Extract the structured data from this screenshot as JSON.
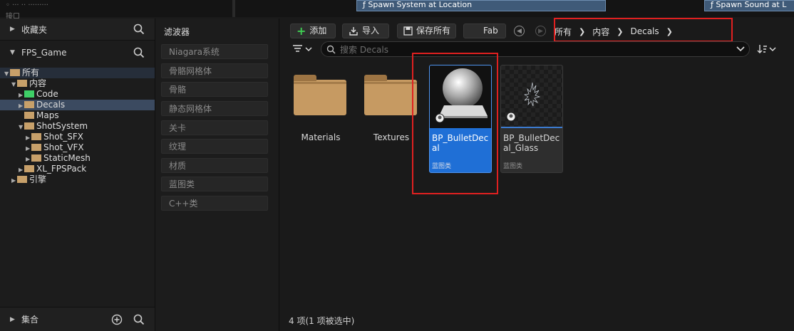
{
  "background_strip": {
    "ghost_text": "◦ ··· ·· ·········",
    "ghost_text2": "接口",
    "node1": "Spawn System at Location",
    "node2": "Spawn Sound at L"
  },
  "tree_panel": {
    "favorites": "收藏夹",
    "project": "FPS_Game",
    "collections": "集合",
    "items": [
      {
        "label": "所有"
      },
      {
        "label": "内容"
      },
      {
        "label": "Code"
      },
      {
        "label": "Decals"
      },
      {
        "label": "Maps"
      },
      {
        "label": "ShotSystem"
      },
      {
        "label": "Shot_SFX"
      },
      {
        "label": "Shot_VFX"
      },
      {
        "label": "StaticMesh"
      },
      {
        "label": "XL_FPSPack"
      },
      {
        "label": "引擎"
      }
    ]
  },
  "filter_panel": {
    "title": "滤波器",
    "items": [
      "Niagara系统",
      "骨骼网格体",
      "骨骼",
      "静态网格体",
      "关卡",
      "纹理",
      "材质",
      "蓝图类",
      "C++类"
    ]
  },
  "toolbar": {
    "add": "添加",
    "import": "导入",
    "save_all": "保存所有",
    "fab": "Fab"
  },
  "breadcrumb": [
    "所有",
    "内容",
    "Decals"
  ],
  "search": {
    "placeholder": "搜索 Decals"
  },
  "assets": {
    "folders": [
      {
        "label": "Materials"
      },
      {
        "label": "Textures"
      }
    ],
    "items": [
      {
        "name": "BP_BulletDecal",
        "type": "蓝图类",
        "selected": true
      },
      {
        "name": "BP_BulletDecal_Glass",
        "type": "蓝图类",
        "selected": false
      }
    ]
  },
  "status_text": "4 项(1 项被选中)",
  "colors": {
    "highlight_box": "#e02020",
    "selection": "#1f6fd6",
    "folder": "#c69a62",
    "code_folder": "#3ecf67"
  }
}
